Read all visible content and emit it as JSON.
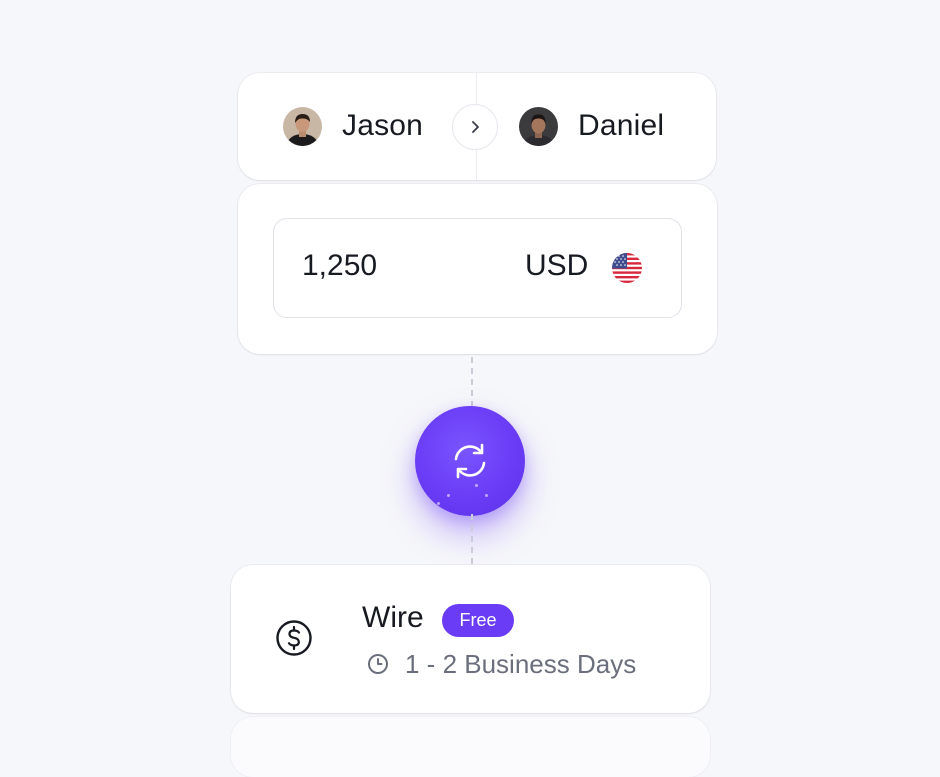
{
  "transfer": {
    "sender": {
      "name": "Jason"
    },
    "recipient": {
      "name": "Daniel"
    }
  },
  "amount": {
    "value": "1,250",
    "currency": "USD"
  },
  "method": {
    "title": "Wire",
    "badge": "Free",
    "eta": "1 - 2 Business Days"
  },
  "icons": {
    "arrow": "chevron-right-icon",
    "swap": "refresh-icon",
    "method": "dollar-icon",
    "eta": "clock-icon",
    "flag": "us-flag-icon"
  },
  "colors": {
    "accent": "#6a3cf6",
    "background": "#f6f7fa",
    "card": "#ffffff",
    "text": "#181a22",
    "muted": "#6b6f7d"
  }
}
